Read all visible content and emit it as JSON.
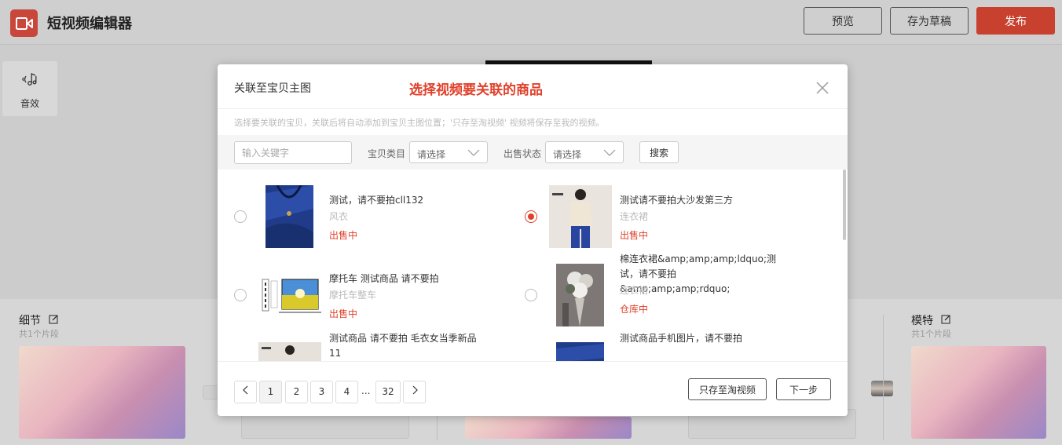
{
  "app": {
    "title": "短视频编辑器"
  },
  "header": {
    "preview_label": "预览",
    "draft_label": "存为草稿",
    "publish_label": "发布"
  },
  "side_tool": {
    "label": "音效",
    "icon": "audio-effect-icon"
  },
  "timeline": {
    "left_segment": {
      "title": "细节",
      "sub": "共1个片段"
    },
    "right_segment": {
      "title": "模特",
      "sub": "共1个片段"
    }
  },
  "modal": {
    "title": "关联至宝贝主图",
    "annotation": "选择视频要关联的商品",
    "hint": "选择要关联的宝贝，关联后将自动添加到宝贝主图位置；'只存至淘视频' 视频将保存至我的视频。",
    "filters": {
      "keyword_placeholder": "输入关键字",
      "category_label": "宝贝类目",
      "category_value": "请选择",
      "status_label": "出售状态",
      "status_value": "请选择",
      "search_label": "搜索"
    },
    "items": [
      {
        "name": "测试，请不要拍cll132",
        "category": "风衣",
        "status": "出售中",
        "selected": false
      },
      {
        "name": "测试请不要拍大沙发第三方",
        "category": "连衣裙",
        "status": "出售中",
        "selected": true
      },
      {
        "name": "摩托车 测试商品 请不要拍",
        "category": "摩托车整车",
        "status": "出售中",
        "selected": false
      },
      {
        "name": "棉连衣裙&amp;amp;amp;ldquo;测试，请不要拍&amp;amp;amp;rdquo;",
        "category": "连衣裙",
        "status": "仓库中",
        "selected": false
      },
      {
        "name": "测试商品 请不要拍 毛衣女当季新品11",
        "category": "",
        "status": "",
        "selected": false
      },
      {
        "name": "测试商品手机图片，请不要拍",
        "category": "",
        "status": "",
        "selected": false
      }
    ],
    "pagination": {
      "pages": [
        "1",
        "2",
        "3",
        "4"
      ],
      "ellipsis": "...",
      "last": "32",
      "current": 1
    },
    "footer": {
      "save_only_label": "只存至淘视频",
      "next_label": "下一步"
    }
  },
  "colors": {
    "accent": "#e0402a",
    "publish": "#c8412f"
  }
}
